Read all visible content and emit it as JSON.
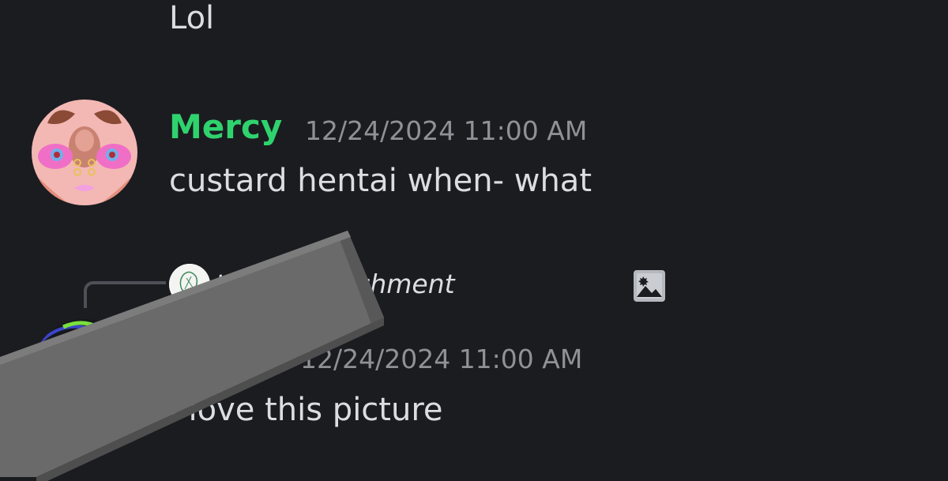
{
  "previous_message": {
    "text": "Lol"
  },
  "message1": {
    "author": "Mercy",
    "author_color": "#2fd36e",
    "timestamp": "12/24/2024 11:00 AM",
    "text": "custard hentai when- what"
  },
  "reply": {
    "text": "to see attachment",
    "icon": "image-icon"
  },
  "message2": {
    "timestamp": "12/24/2024 11:00 AM",
    "text": "I love this picture"
  },
  "colors": {
    "background": "#1b1c20",
    "text": "#dbdee1",
    "muted": "#8e9297"
  }
}
